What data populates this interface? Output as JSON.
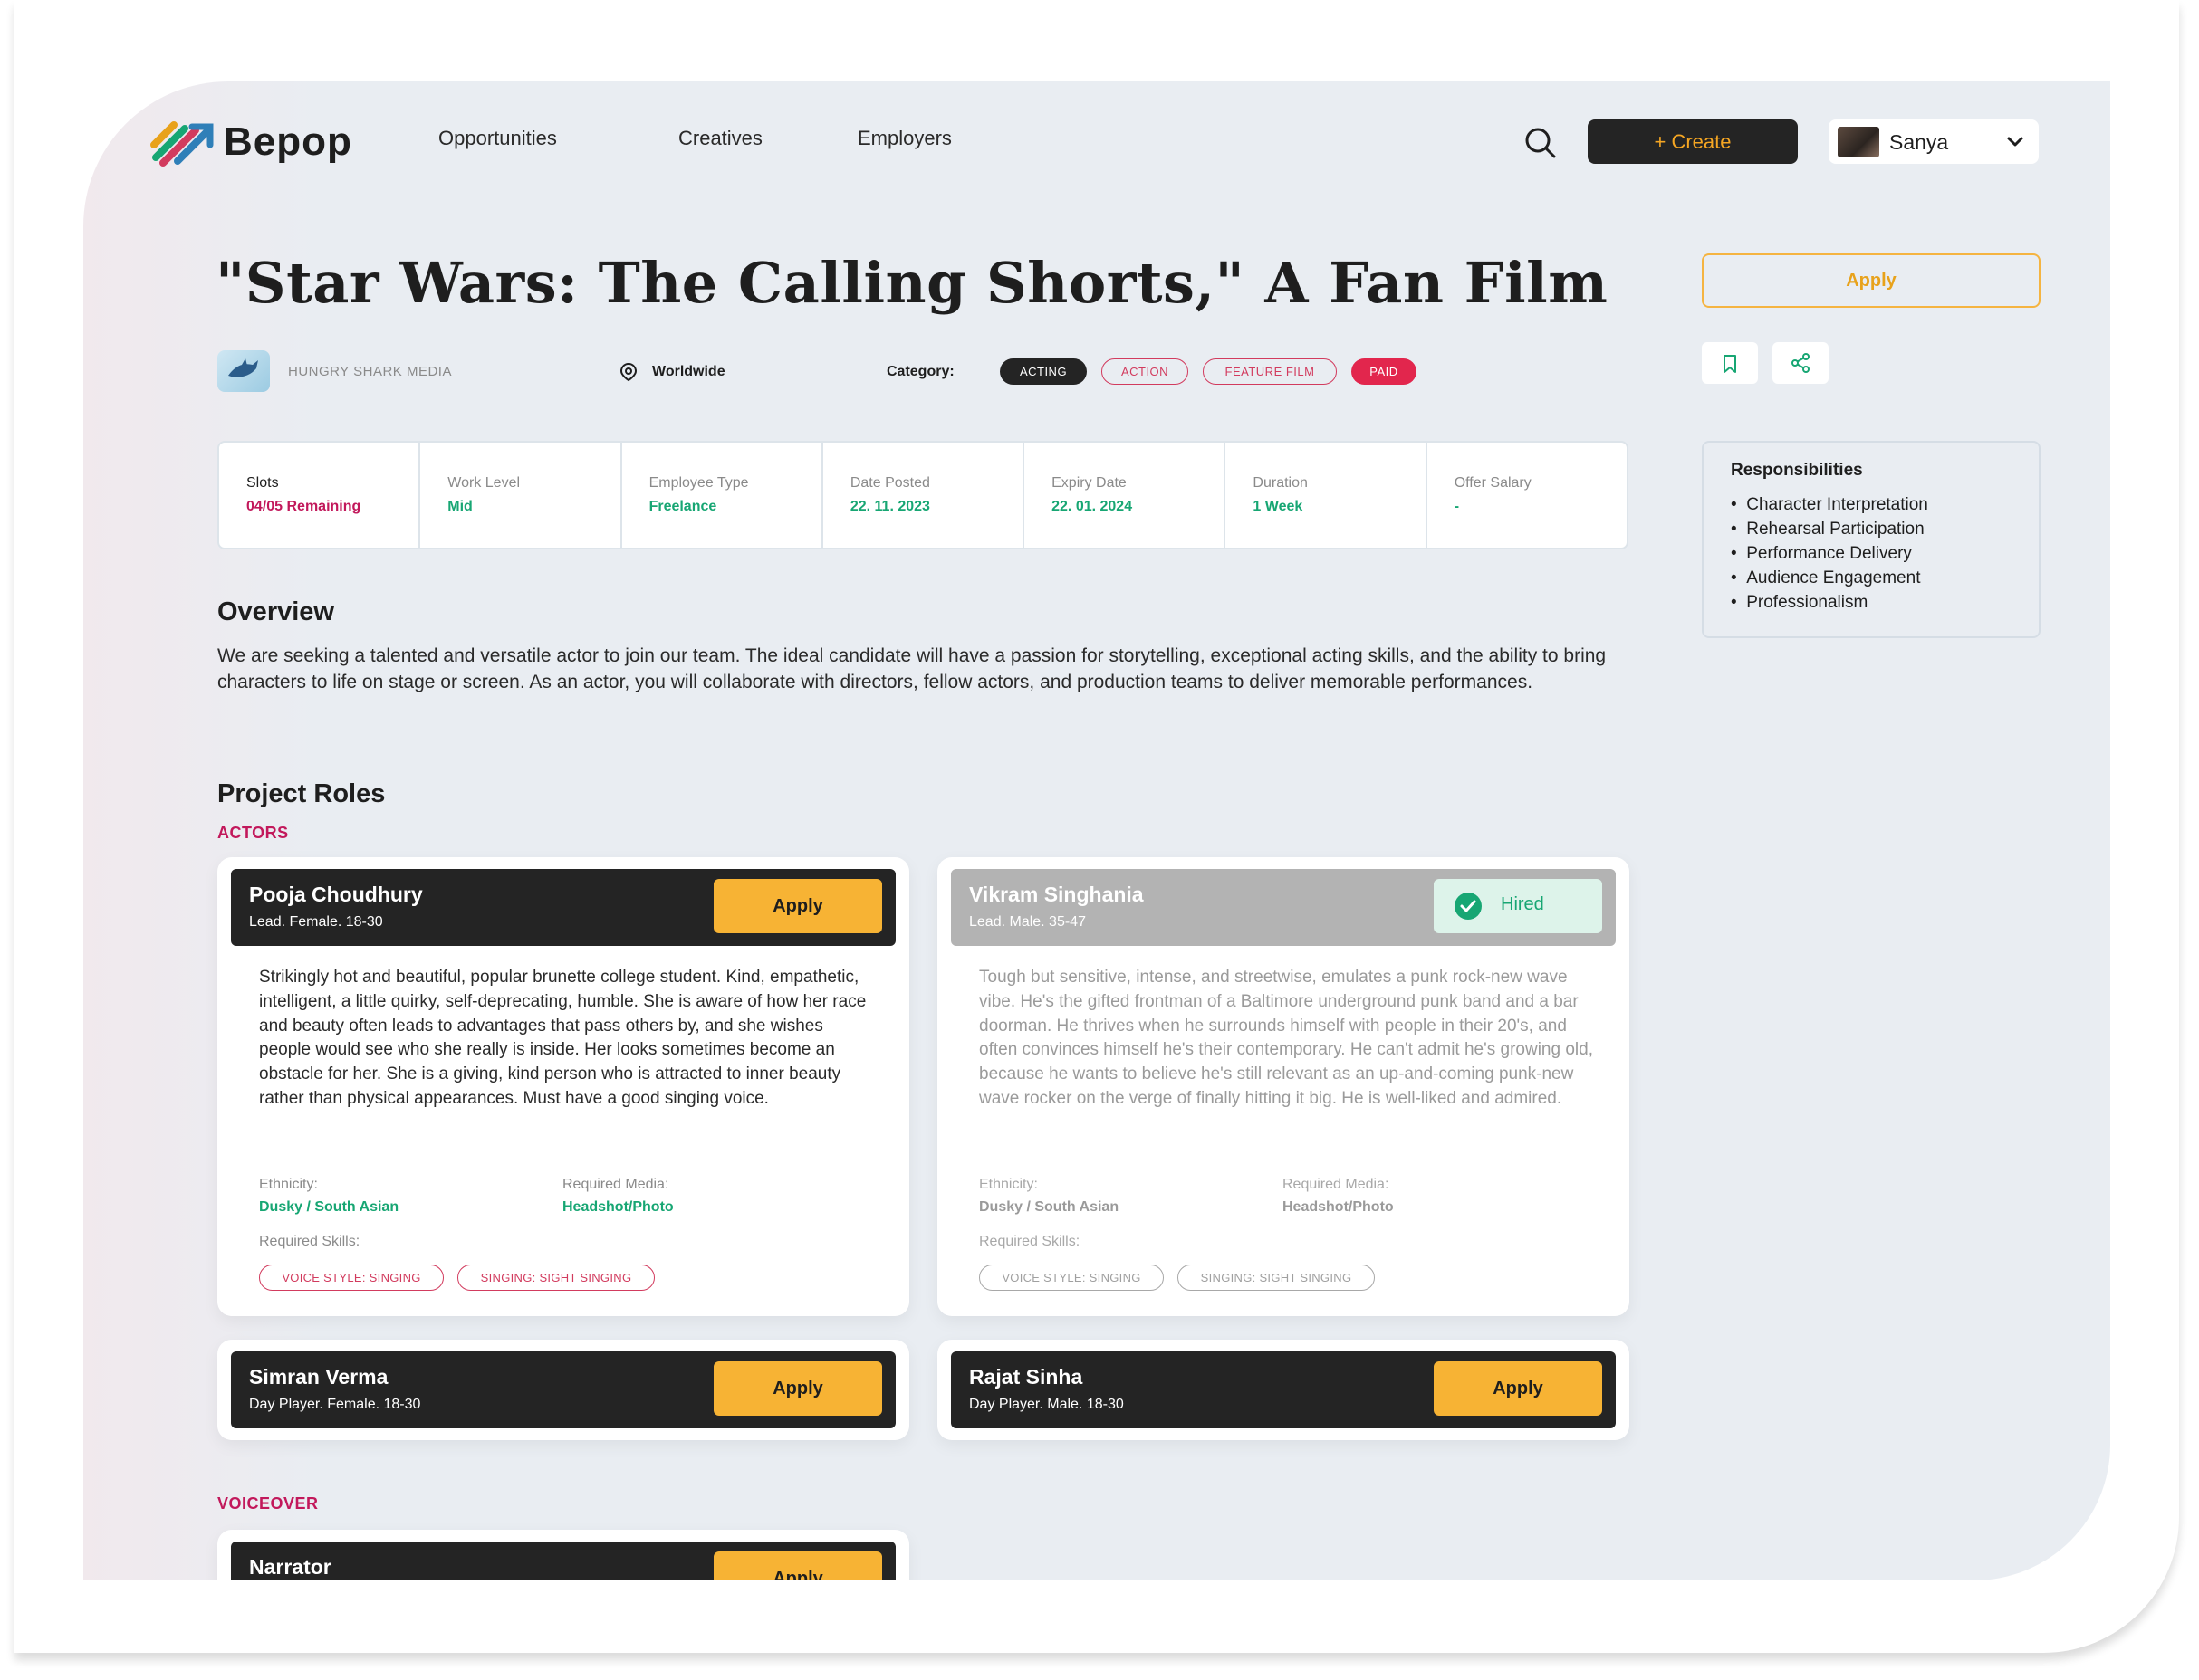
{
  "header": {
    "brand": "Bepop",
    "nav": [
      "Opportunities",
      "Creatives",
      "Employers"
    ],
    "create_label": "+ Create",
    "user_name": "Sanya"
  },
  "job": {
    "title": "\"Star Wars: The Calling Shorts,\" A Fan Film",
    "company": "HUNGRY SHARK MEDIA",
    "location": "Worldwide",
    "category_label": "Category:",
    "tags": [
      "ACTING",
      "ACTION",
      "FEATURE FILM",
      "PAID"
    ]
  },
  "side": {
    "apply_label": "Apply",
    "responsibilities_title": "Responsibilities",
    "responsibilities": [
      "Character Interpretation",
      "Rehearsal Participation",
      "Performance Delivery",
      "Audience Engagement",
      "Professionalism"
    ]
  },
  "stats": [
    {
      "label": "Slots",
      "value": "04/05 Remaining"
    },
    {
      "label": "Work Level",
      "value": "Mid"
    },
    {
      "label": "Employee Type",
      "value": "Freelance"
    },
    {
      "label": "Date Posted",
      "value": "22. 11. 2023"
    },
    {
      "label": "Expiry Date",
      "value": "22. 01. 2024"
    },
    {
      "label": "Duration",
      "value": "1 Week"
    },
    {
      "label": "Offer Salary",
      "value": "-"
    }
  ],
  "overview": {
    "title": "Overview",
    "text": "We are seeking a talented and versatile actor to join our team. The ideal candidate will have a passion for storytelling, exceptional acting skills, and the ability to bring characters to life on stage or screen. As an actor, you will collaborate with directors, fellow actors, and production teams to deliver memorable performances."
  },
  "roles": {
    "title": "Project Roles",
    "actors_label": "ACTORS",
    "voiceover_label": "VOICEOVER",
    "apply_label": "Apply",
    "hired_label": "Hired",
    "meta_labels": {
      "ethnicity": "Ethnicity:",
      "media": "Required Media:",
      "skills": "Required Skills:"
    },
    "cards": [
      {
        "name": "Pooja Choudhury",
        "sub": "Lead. Female. 18-30",
        "description": "Strikingly hot and beautiful, popular brunette college student. Kind, empathetic, intelligent, a little quirky, self-deprecating, humble. She is aware of how her race and beauty often leads to advantages that pass others by, and she wishes people would see who she really is inside. Her looks sometimes become an obstacle for her. She is a giving, kind person who is attracted to inner beauty rather than physical appearances. Must have a good singing voice.",
        "ethnicity": "Dusky / South Asian",
        "media": "Headshot/Photo",
        "skills": [
          "VOICE STYLE: SINGING",
          "SINGING: SIGHT SINGING"
        ]
      },
      {
        "name": "Vikram Singhania",
        "sub": "Lead. Male. 35-47",
        "description": "Tough but sensitive, intense, and streetwise, emulates a punk rock-new wave vibe. He's the gifted frontman of a Baltimore underground punk band and a bar doorman. He thrives when he surrounds himself with people in their 20's, and often convinces himself he's their contemporary. He can't admit he's growing old, because he wants to believe he's still relevant as an up-and-coming punk-new wave rocker on the verge of finally hitting it big. He is well-liked and admired.",
        "ethnicity": "Dusky / South Asian",
        "media": "Headshot/Photo",
        "skills": [
          "VOICE STYLE: SINGING",
          "SINGING: SIGHT SINGING"
        ]
      },
      {
        "name": "Simran Verma",
        "sub": "Day Player. Female. 18-30"
      },
      {
        "name": "Rajat Sinha",
        "sub": "Day Player. Male. 18-30"
      },
      {
        "name": "Narrator"
      }
    ]
  },
  "colors": {
    "accent_yellow": "#f7b334",
    "accent_pink": "#c2185b",
    "accent_green": "#17a673",
    "dark": "#242424"
  }
}
